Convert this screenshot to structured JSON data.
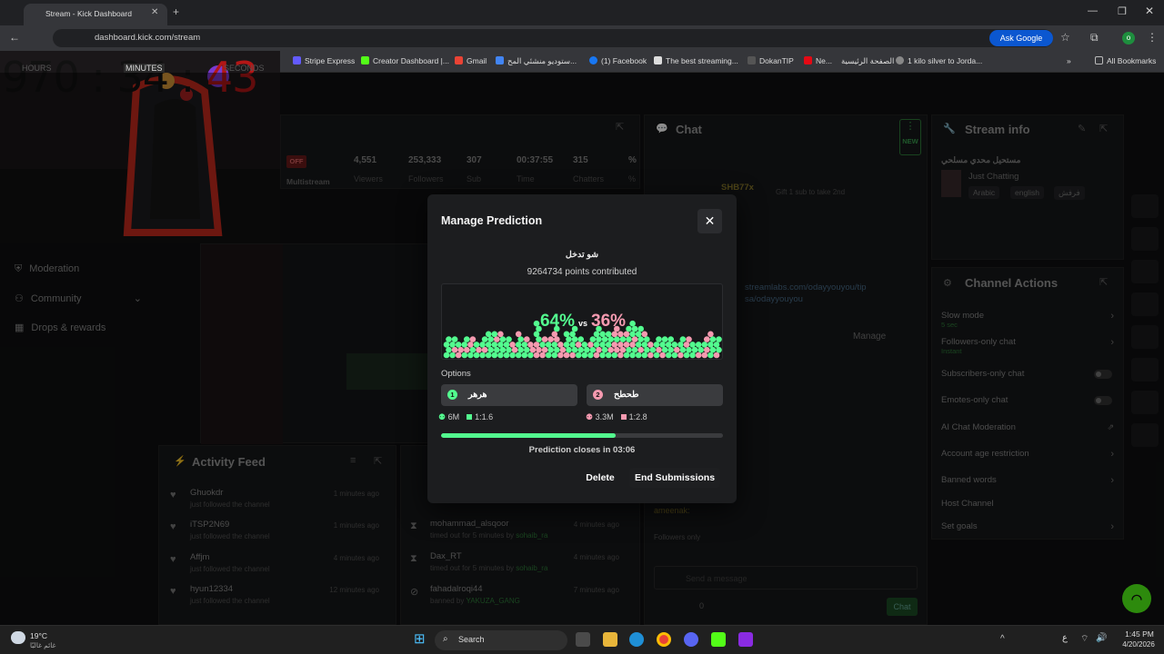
{
  "browser": {
    "tab_title": "Stream - Kick Dashboard",
    "url": "dashboard.kick.com/stream",
    "ask_google": "Ask Google",
    "all_bookmarks": "All Bookmarks",
    "bookmarks": [
      "Stripe Express",
      "Creator Dashboard |...",
      "Gmail",
      "ستوديو منشئي المح...",
      "(1) Facebook",
      "The best streaming...",
      "DokanTIP",
      "Ne...",
      "الصفحة الرئيسية",
      "1 kilo silver to Jorda..."
    ]
  },
  "webcam": {
    "timer_part1": "970 : 34 : ",
    "timer_part2": "43",
    "label_hours": "HOURS",
    "label_minutes": "MINUTES",
    "label_seconds": "SECONDS"
  },
  "stats": {
    "status": "OFF",
    "multistream": "Multistream",
    "items": [
      {
        "value": "4,551",
        "label": "Viewers"
      },
      {
        "value": "253,333",
        "label": "Followers"
      },
      {
        "value": "307",
        "label": "Sub"
      },
      {
        "value": "00:37:55",
        "label": "Time"
      },
      {
        "value": "315",
        "label": "Chatters"
      },
      {
        "value": "%",
        "label": "%"
      }
    ]
  },
  "nav": {
    "items": [
      "Moderation",
      "Community",
      "Drops & rewards"
    ]
  },
  "activity": {
    "title": "Activity Feed",
    "rows": [
      {
        "name": "Ghuokdr",
        "sub": "just followed the channel",
        "time": "1 minutes ago"
      },
      {
        "name": "iTSP2N69",
        "sub": "just followed the channel",
        "time": "1 minutes ago"
      },
      {
        "name": "Affjm",
        "sub": "just followed the channel",
        "time": "4 minutes ago"
      },
      {
        "name": "hyun12334",
        "sub": "just followed the channel",
        "time": "12 minutes ago"
      }
    ]
  },
  "mod_log": {
    "rows": [
      {
        "name": "mohammad_alsqoor",
        "sub": "timed out for 5 minutes by",
        "by": "sohaib_ra",
        "time": "4 minutes ago"
      },
      {
        "name": "Dax_RT",
        "sub": "timed out for 5 minutes by",
        "by": "sohaib_ra",
        "time": "4 minutes ago"
      },
      {
        "name": "fahadalroqi44",
        "sub": "banned by",
        "by": "YAKUZA_GANG",
        "time": "7 minutes ago"
      }
    ]
  },
  "chat": {
    "title": "Chat",
    "new_badge": "NEW",
    "gift_user": "SHB77x",
    "gift_text": "Gift 1 sub to take 2nd",
    "pinned_link": "streamlabs.com/odayyouyou/tip",
    "pinned_link2": "sa/odayyouyou",
    "manage": "Manage",
    "followers_only": "Followers only",
    "input_placeholder": "Send a message",
    "send_label": "Chat",
    "count": "0",
    "msg_user": "ameenak:"
  },
  "stream_info": {
    "title": "Stream info",
    "stream_title": "مستحيل محدي مسلحي",
    "category": "Just Chatting",
    "tags": [
      "Arabic",
      "english",
      "فرفش"
    ]
  },
  "channel_actions": {
    "title": "Channel Actions",
    "items": [
      {
        "label": "Slow mode",
        "sub": "5 sec",
        "type": "chevron"
      },
      {
        "label": "Followers-only chat",
        "sub": "Instant",
        "type": "chevron"
      },
      {
        "label": "Subscribers-only chat",
        "sub": "",
        "type": "toggle"
      },
      {
        "label": "Emotes-only chat",
        "sub": "",
        "type": "toggle"
      },
      {
        "label": "AI Chat Moderation",
        "sub": "",
        "type": "icon"
      },
      {
        "label": "Account age restriction",
        "sub": "",
        "type": "chevron"
      },
      {
        "label": "Banned words",
        "sub": "",
        "type": "chevron"
      },
      {
        "label": "Host Channel",
        "sub": "",
        "type": "none"
      },
      {
        "label": "Set goals",
        "sub": "",
        "type": "chevron"
      }
    ]
  },
  "prediction": {
    "title": "Manage Prediction",
    "question": "شو تدخل",
    "points": "9264734 points contributed",
    "pct_a": "64%",
    "vs": "vs",
    "pct_b": "36%",
    "share_a": 0.64,
    "options_label": "Options",
    "option_a": {
      "num": "1",
      "label": "هرهر",
      "points": "6M",
      "ratio": "1:1.6",
      "color": "#53fc8f"
    },
    "option_b": {
      "num": "2",
      "label": "طحطح",
      "points": "3.3M",
      "ratio": "1:2.8",
      "color": "#f59ab0"
    },
    "time_progress": 0.62,
    "closes": "Prediction closes in 03:06",
    "delete": "Delete",
    "end": "End Submissions"
  },
  "taskbar": {
    "weather_temp": "19°C",
    "weather_desc": "غائم غالبًا",
    "search": "Search",
    "time": "1:45 PM",
    "date": "4/20/2026",
    "lang": "ع"
  }
}
